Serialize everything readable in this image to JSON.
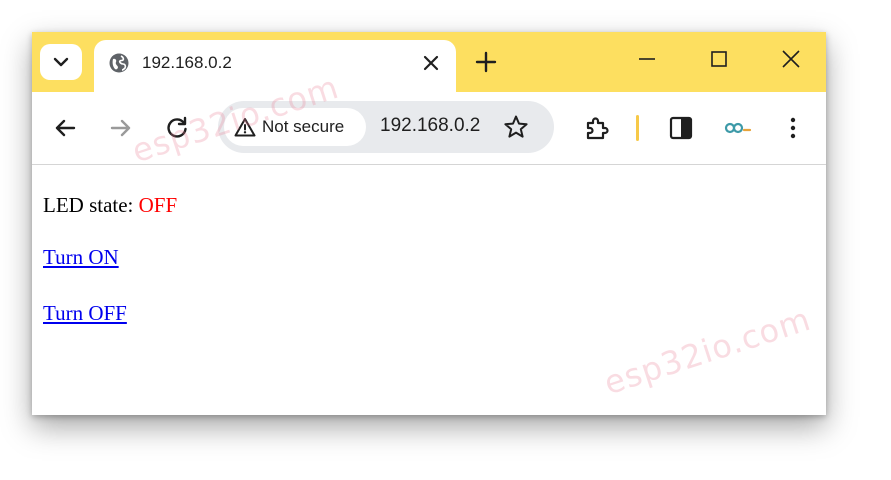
{
  "browser": {
    "tab": {
      "title": "192.168.0.2",
      "favicon": "globe-icon"
    },
    "omnibox": {
      "security_label": "Not secure",
      "url": "192.168.0.2"
    },
    "colors": {
      "tabstrip": "#fddf60",
      "omnibox": "#e8eaed",
      "divider": "#f7c948"
    }
  },
  "page": {
    "led_label": "LED state:",
    "led_state": "OFF",
    "led_state_color": "#ff0000",
    "links": {
      "turn_on": "Turn ON",
      "turn_off": "Turn OFF"
    }
  },
  "watermark": {
    "text": "esp32io.com"
  }
}
